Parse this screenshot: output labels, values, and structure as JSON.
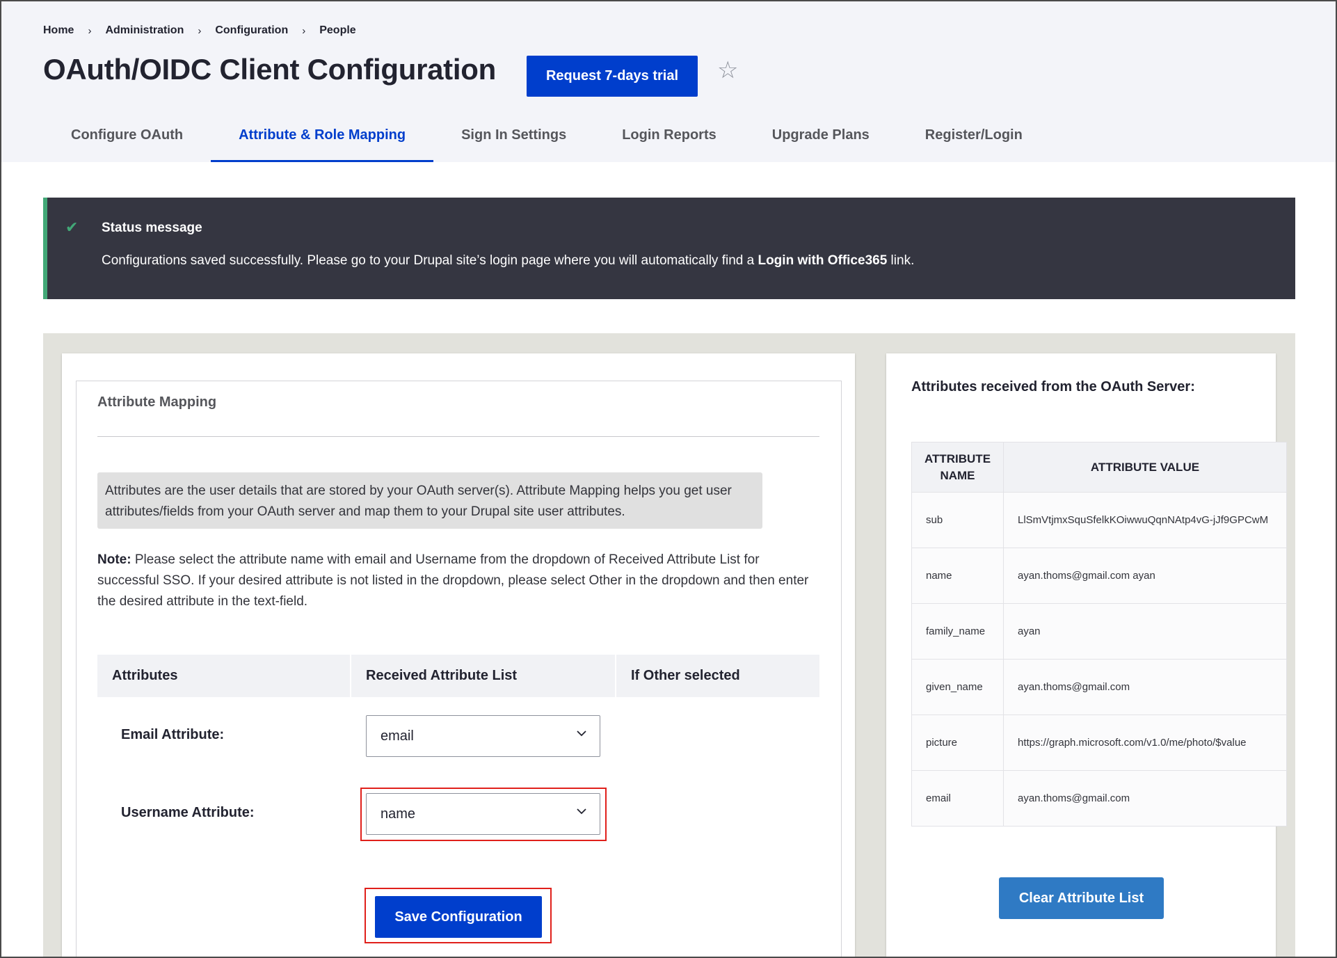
{
  "breadcrumb": [
    "Home",
    "Administration",
    "Configuration",
    "People"
  ],
  "breadcrumb_sep": "›",
  "page": {
    "title": "OAuth/OIDC Client Configuration",
    "trial_button": "Request 7-days trial",
    "star_icon": "☆"
  },
  "tabs": [
    {
      "label": "Configure OAuth",
      "active": false
    },
    {
      "label": "Attribute & Role Mapping",
      "active": true
    },
    {
      "label": "Sign In Settings",
      "active": false
    },
    {
      "label": "Login Reports",
      "active": false
    },
    {
      "label": "Upgrade Plans",
      "active": false
    },
    {
      "label": "Register/Login",
      "active": false
    }
  ],
  "status": {
    "icon": "✔",
    "title": "Status message",
    "message_prefix": "Configurations saved successfully. Please go to your Drupal site’s login page where you will automatically find a ",
    "message_bold": "Login with Office365",
    "message_suffix": " link."
  },
  "mapping": {
    "legend": "Attribute Mapping",
    "info": "Attributes are the user details that are stored by your OAuth server(s). Attribute Mapping helps you get user attributes/fields from your OAuth server and map them to your Drupal site user attributes.",
    "note_label": "Note:",
    "note_text": " Please select the attribute name with email and Username from the dropdown of Received Attribute List for successful SSO. If your desired attribute is not listed in the dropdown, please select Other in the dropdown and then enter the desired attribute in the text-field.",
    "columns": [
      "Attributes",
      "Received Attribute List",
      "If Other selected"
    ],
    "email_label": "Email Attribute:",
    "email_value": "email",
    "username_label": "Username Attribute:",
    "username_value": "name",
    "save_button": "Save Configuration"
  },
  "received": {
    "title": "Attributes received from the OAuth Server:",
    "col_name": "ATTRIBUTE NAME",
    "col_value": "ATTRIBUTE VALUE",
    "rows": [
      {
        "name": "sub",
        "value": "LlSmVtjmxSquSfelkKOiwwuQqnNAtp4vG-jJf9GPCwM"
      },
      {
        "name": "name",
        "value": "ayan.thoms@gmail.com ayan"
      },
      {
        "name": "family_name",
        "value": "ayan"
      },
      {
        "name": "given_name",
        "value": "ayan.thoms@gmail.com"
      },
      {
        "name": "picture",
        "value": "https://graph.microsoft.com/v1.0/me/photo/$value"
      },
      {
        "name": "email",
        "value": "ayan.thoms@gmail.com"
      }
    ],
    "clear_button": "Clear Attribute List"
  },
  "colors": {
    "primary": "#003ecc",
    "status_bg": "#353641",
    "status_accent": "#42a877",
    "highlight": "#e0201b",
    "clear_button": "#2f7ac4"
  }
}
